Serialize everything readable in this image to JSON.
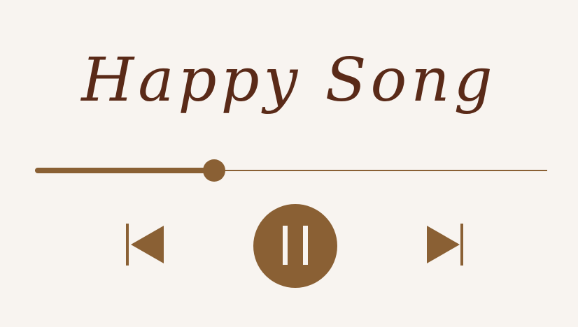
{
  "song": {
    "title": "Happy Song"
  },
  "playback": {
    "progress_fraction": 0.35,
    "state": "playing"
  },
  "controls": {
    "previous_icon": "skip-previous-icon",
    "pause_icon": "pause-icon",
    "next_icon": "skip-next-icon"
  },
  "colors": {
    "background": "#f8f4f0",
    "accent": "#8a6034",
    "title": "#5a2a18"
  }
}
